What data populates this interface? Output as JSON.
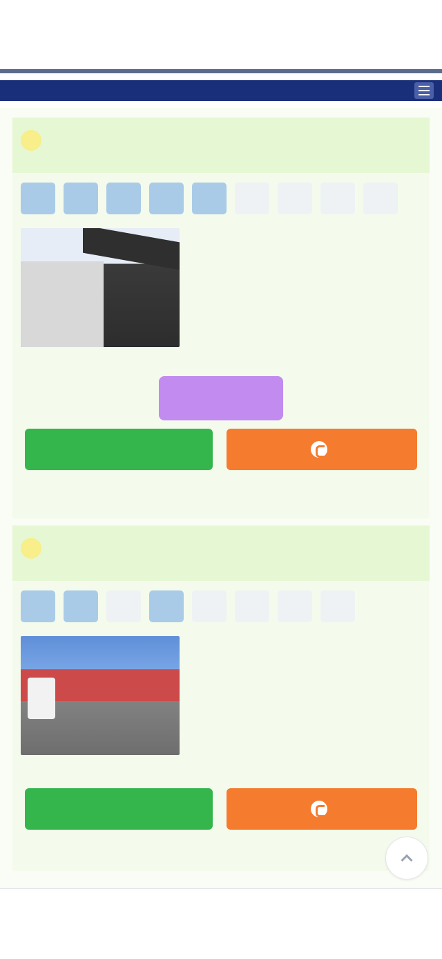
{
  "header": {
    "site_title": "",
    "header_link": ""
  },
  "listings": [
    {
      "subtitle": "",
      "company": "",
      "tags": [
        {
          "label": "",
          "active": true
        },
        {
          "label": "",
          "active": true
        },
        {
          "label": "",
          "active": true
        },
        {
          "label": "",
          "active": true
        },
        {
          "label": "",
          "active": true
        },
        {
          "label": "",
          "active": false
        },
        {
          "label": "",
          "active": false
        },
        {
          "label": "",
          "active": false
        },
        {
          "label": "",
          "active": false
        }
      ],
      "shop_name": "",
      "postal": "",
      "address": "",
      "tel": "",
      "purple_button": "",
      "detail_button": "",
      "call_button": "",
      "note": ""
    },
    {
      "subtitle": "",
      "company": "",
      "tags": [
        {
          "label": "",
          "active": true
        },
        {
          "label": "",
          "active": true
        },
        {
          "label": "",
          "active": false
        },
        {
          "label": "",
          "active": true
        },
        {
          "label": "",
          "active": false
        },
        {
          "label": "",
          "active": false
        },
        {
          "label": "",
          "active": false
        },
        {
          "label": "",
          "active": false
        }
      ],
      "shop_name": "",
      "postal": "",
      "address": "",
      "tel": "",
      "detail_button": "",
      "call_button": "",
      "note": ""
    }
  ],
  "colors": {
    "header_bg": "#1a2f7a",
    "card_bg": "#f4fbec",
    "card_head_bg": "#e6f7d3",
    "tag_active": "#a9cbe8",
    "tag_inactive": "#eef2f5",
    "purple": "#c28bef",
    "green": "#34b64d",
    "orange": "#f57b2f"
  },
  "icons": {
    "menu": "hamburger-icon",
    "badge": "sun-badge-icon",
    "phone": "phone-icon",
    "scroll_top": "chevron-up-icon"
  }
}
